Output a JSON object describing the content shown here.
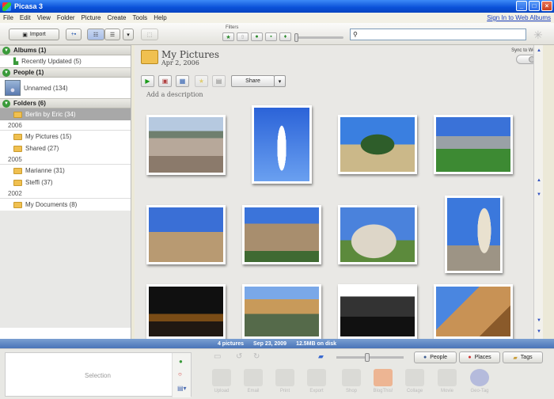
{
  "window": {
    "title": "Picasa 3"
  },
  "menu": {
    "items": [
      "File",
      "Edit",
      "View",
      "Folder",
      "Picture",
      "Create",
      "Tools",
      "Help"
    ],
    "signin": "Sign In to Web Albums"
  },
  "toolbar": {
    "import_label": "Import",
    "filters_label": "Filters",
    "search_placeholder": ""
  },
  "sidebar": {
    "albums": "Albums (1)",
    "recently_updated": "Recently Updated (5)",
    "people": "People (1)",
    "unnamed": "Unnamed (134)",
    "folders": "Folders (6)",
    "berlin": "Berlin by Eric (34)",
    "year_2006": "2006",
    "my_pictures": "My Pictures (15)",
    "shared": "Shared (27)",
    "year_2005": "2005",
    "marianne": "Marianne (31)",
    "steffi": "Steffi (37)",
    "year_2002": "2002",
    "my_documents": "My Documents (8)"
  },
  "main": {
    "folder_title": "My Pictures",
    "folder_date": "Apr 2, 2006",
    "sync_label": "Sync to Web",
    "share_label": "Share",
    "description_placeholder": "Add a description"
  },
  "status": {
    "count": "4 pictures",
    "date": "Sep 23, 2009",
    "size": "12.5MB on disk"
  },
  "bottom": {
    "selection_label": "Selection",
    "people": "People",
    "places": "Places",
    "tags": "Tags",
    "actions": [
      "Upload",
      "Email",
      "Print",
      "Export",
      "Shop",
      "BlogThis!",
      "Collage",
      "Movie",
      "Geo-Tag"
    ]
  }
}
